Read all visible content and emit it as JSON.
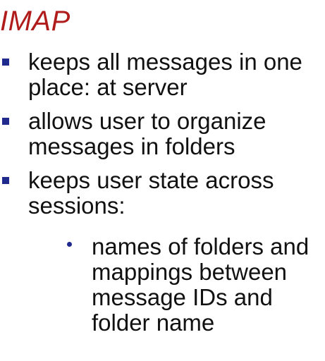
{
  "title": "IMAP",
  "bullets": [
    {
      "text": "keeps all messages in one place: at server"
    },
    {
      "text": "allows user to organize messages in folders"
    },
    {
      "text": "keeps user state across sessions:"
    }
  ],
  "sub_bullets": [
    {
      "text": "names of folders and mappings between message IDs and folder name"
    }
  ],
  "colors": {
    "title": "#b01c1c",
    "bullet_marker": "#1f2a8c",
    "text": "#111111",
    "background": "#ffffff"
  }
}
